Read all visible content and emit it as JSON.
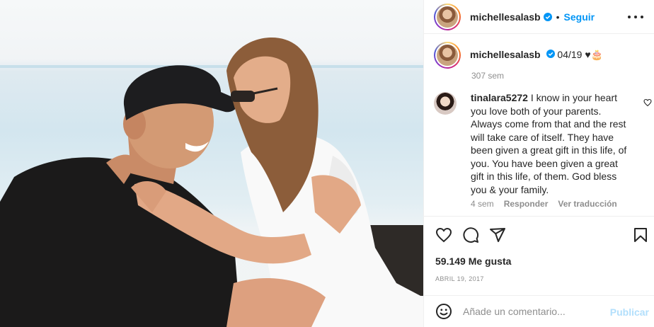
{
  "post": {
    "image_alt": "Hombre con gorra negra y mujer con vestido blanco sonriéndose frente al mar"
  },
  "header": {
    "username": "michellesalasb",
    "verified_icon": "verified-badge-icon",
    "separator": "•",
    "follow_label": "Seguir",
    "more_icon": "more-options-icon"
  },
  "caption": {
    "username": "michellesalasb",
    "text": "04/19 ♥🎂",
    "time": "307 sem"
  },
  "comment": {
    "username": "tinalara5272",
    "text": "I know in your heart you love both of your parents. Always come from that and the rest will take care of itself. They have been given a great gift in this life, of you. You have been given a great gift in this life, of them. God bless you & your family.",
    "time": "4 sem",
    "reply_label": "Responder",
    "translate_label": "Ver traducción"
  },
  "actions": {
    "likes": "59.149 Me gusta",
    "date": "ABRIL 19, 2017"
  },
  "add_comment": {
    "placeholder": "Añade un comentario...",
    "publish_label": "Publicar"
  },
  "colors": {
    "accent": "#0095f6",
    "publish_disabled": "#b2dffc",
    "muted_text": "#8e8e8e",
    "text": "#262626"
  }
}
